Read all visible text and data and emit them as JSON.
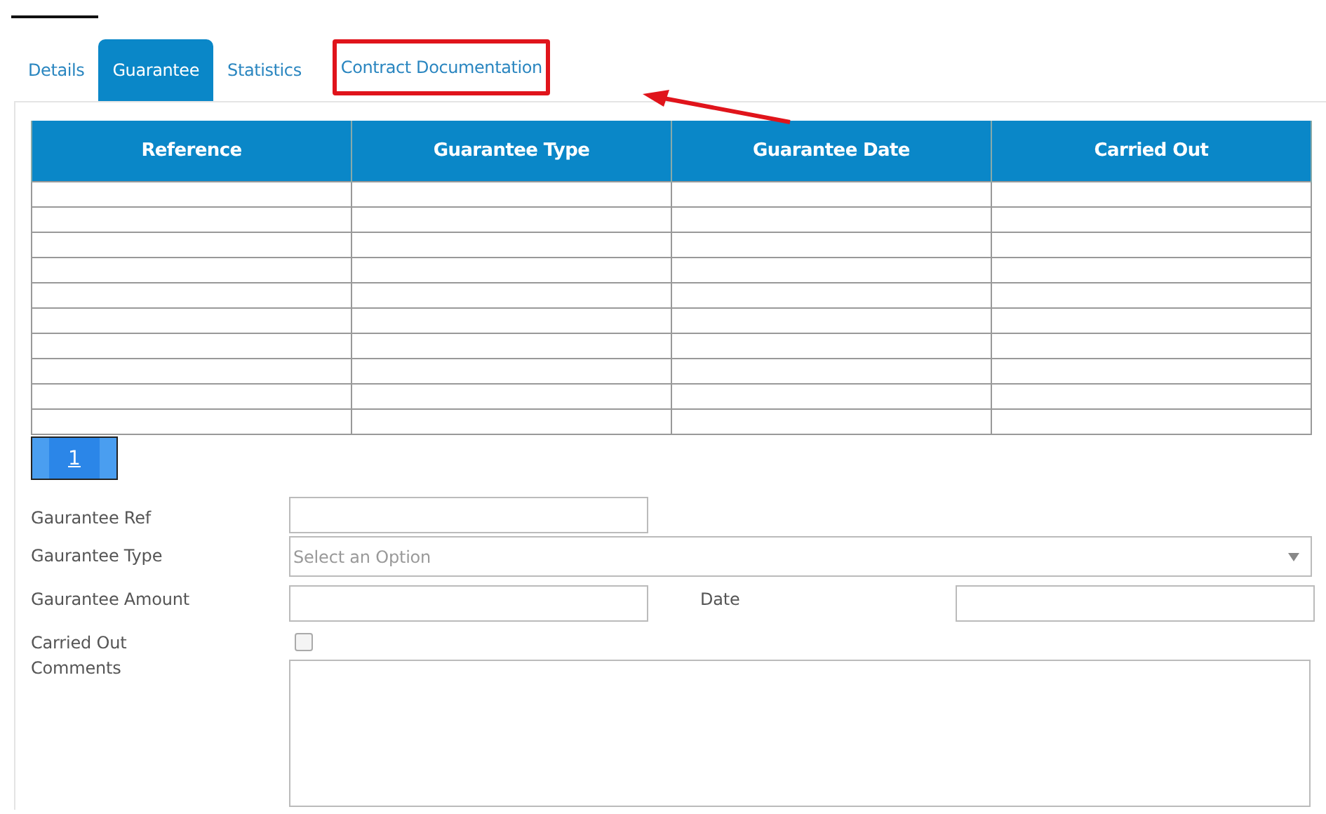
{
  "tabs": [
    {
      "label": "Details",
      "selected": false,
      "highlighted": false
    },
    {
      "label": "Guarantee",
      "selected": true,
      "highlighted": false
    },
    {
      "label": "Statistics",
      "selected": false,
      "highlighted": false
    },
    {
      "label": "Contract Documentation",
      "selected": false,
      "highlighted": true
    }
  ],
  "table": {
    "columns": [
      "Reference",
      "Guarantee Type",
      "Guarantee Date",
      "Carried Out"
    ]
  },
  "pager": [
    {
      "label": "1",
      "selected": true
    }
  ],
  "form": {
    "ref_label": "Gaurantee Ref",
    "type_label": "Gaurantee Type",
    "type_placeholder": "Select an Option",
    "amount_label": "Gaurantee Amount",
    "date_label": "Date",
    "carried_out_label": "Carried Out",
    "carried_out": false,
    "comments_label": "Comments"
  }
}
